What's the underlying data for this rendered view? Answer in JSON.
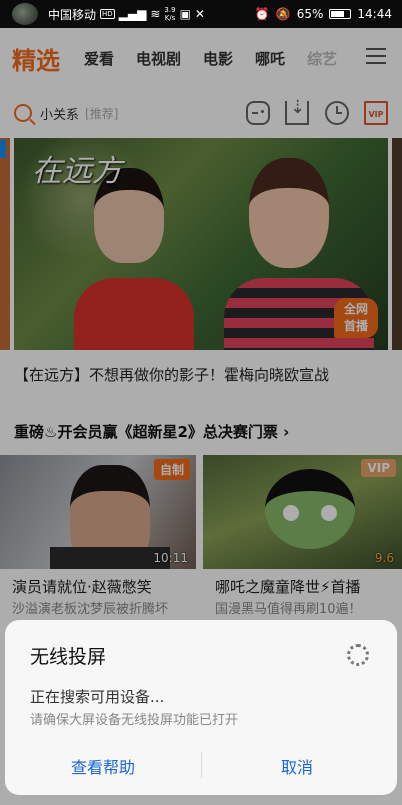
{
  "status_bar": {
    "carrier": "中国移动",
    "hd": "HD",
    "speed": "3.9\nK/s",
    "battery": "65%",
    "time": "14:44"
  },
  "tabs": [
    "精选",
    "爱看",
    "电视剧",
    "电影",
    "哪吒",
    "综艺"
  ],
  "search": {
    "text": "小关系",
    "hint": "[推荐]",
    "vip_label": "VIP"
  },
  "hero": {
    "title_art": "在远方",
    "badge": "全网\n首播",
    "caption": "【在远方】不想再做你的影子！霍梅向晓欧宣战"
  },
  "promo": "重磅♨开会员赢《超新星2》总决赛门票 ›",
  "cards": [
    {
      "tag": "自制",
      "time": "10:11",
      "title": "演员请就位·赵薇憋笑",
      "subtitle": "沙溢演老板沈梦辰被折腾坏"
    },
    {
      "tag": "VIP",
      "score": "9.6",
      "title": "哪吒之魔童降世⚡首播",
      "subtitle": "国漫黑马值得再刷10遍！"
    }
  ],
  "dialog": {
    "title": "无线投屏",
    "message": "正在搜索可用设备...",
    "hint": "请确保大屏设备无线投屏功能已打开",
    "help_button": "查看帮助",
    "cancel_button": "取消"
  },
  "colors": {
    "accent": "#f36a1a",
    "link": "#1a66d6"
  }
}
